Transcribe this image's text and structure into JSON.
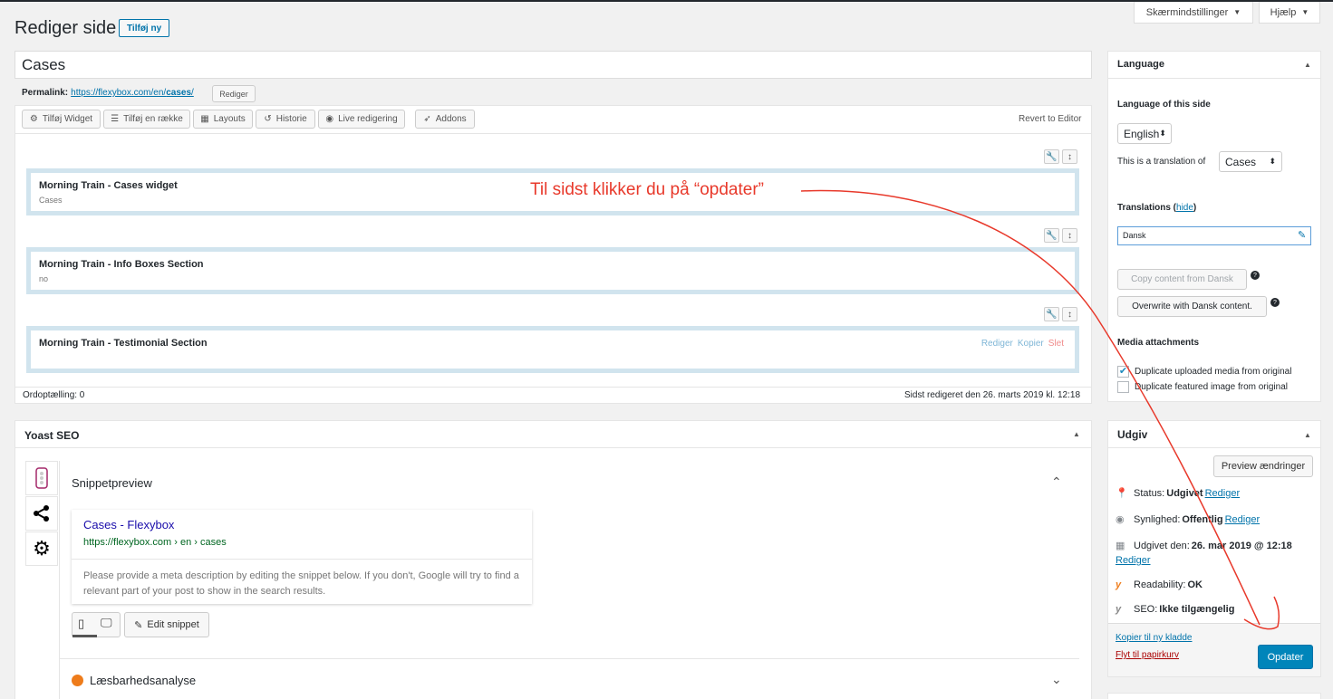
{
  "screen_options": {
    "screen_label": "Skærmindstillinger",
    "help_label": "Hjælp"
  },
  "header": {
    "title": "Rediger side",
    "add_new": "Tilføj ny"
  },
  "post": {
    "title": "Cases",
    "permalink_label": "Permalink:",
    "permalink_base": "https://flexybox.com/en/",
    "permalink_slug": "cases",
    "permalink_end": "/",
    "permalink_edit": "Rediger"
  },
  "builder_toolbar": {
    "add_widget": "Tilføj Widget",
    "add_row": "Tilføj en række",
    "layouts": "Layouts",
    "history": "Historie",
    "live_edit": "Live redigering",
    "addons": "Addons",
    "revert": "Revert to Editor"
  },
  "widgets": [
    {
      "title": "Morning Train - Cases widget",
      "sub": "Cases"
    },
    {
      "title": "Morning Train - Info Boxes Section",
      "sub": "no"
    },
    {
      "title": "Morning Train - Testimonial Section",
      "sub": ""
    }
  ],
  "widget_actions": {
    "edit": "Rediger",
    "copy": "Kopier",
    "delete": "Slet"
  },
  "status_bar": {
    "word_count": "Ordoptælling: 0",
    "last_edited": "Sidst redigeret den 26. marts 2019 kl. 12:18"
  },
  "annotation": {
    "text": "Til sidst klikker du på “opdater”",
    "color": "#e8392b"
  },
  "yoast": {
    "title": "Yoast SEO",
    "snippet_heading": "Snippetpreview",
    "snippet_title": "Cases - Flexybox",
    "snippet_url": "https://flexybox.com › en › cases",
    "snippet_desc": "Please provide a meta description by editing the snippet below. If you don't, Google will try to find a relevant part of your post to show in the search results.",
    "edit_snippet": "Edit snippet",
    "readability_heading": "Læsbarhedsanalyse"
  },
  "language_box": {
    "title": "Language",
    "lang_of_this": "Language of this side",
    "lang_selected": "English",
    "translation_of_label": "This is a translation of",
    "translation_of_value": "Cases",
    "translations_label": "Translations",
    "hide_label": "hide",
    "dansk": "Dansk",
    "copy_btn": "Copy content from Dansk",
    "overwrite_btn": "Overwrite with Dansk content.",
    "media_heading": "Media attachments",
    "dup_media": "Duplicate uploaded media from original",
    "dup_featured": "Duplicate featured image from original"
  },
  "publish_box": {
    "title": "Udgiv",
    "preview_btn": "Preview ændringer",
    "status_label": "Status:",
    "status_value": "Udgivet",
    "visibility_label": "Synlighed:",
    "visibility_value": "Offentlig",
    "published_label": "Udgivet den:",
    "published_value": "26. mar 2019 @ 12:18",
    "edit_link": "Rediger",
    "readability_label": "Readability:",
    "readability_value": "OK",
    "seo_label": "SEO:",
    "seo_value": "Ikke tilgængelig",
    "copy_draft": "Kopier til ny kladde",
    "trash": "Flyt til papirkurv",
    "update_btn": "Opdater"
  },
  "colors": {
    "primary": "#0085ba",
    "link": "#0073aa",
    "trash": "#a00",
    "widget_border": "#d1e4ee"
  }
}
